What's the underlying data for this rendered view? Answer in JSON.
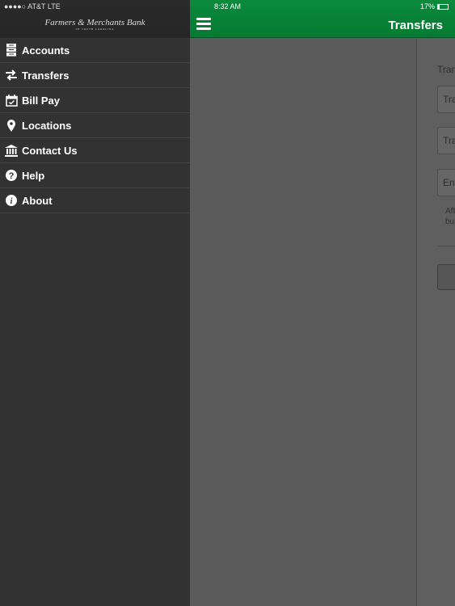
{
  "status_bar": {
    "carrier": "●●●●○ AT&T  LTE",
    "time": "8:32 AM",
    "battery": "17%",
    "battery_level": 0.17
  },
  "sidebar": {
    "logo": "Farmers & Merchants Bank",
    "items": [
      {
        "label": "Accounts",
        "icon": "accounts-icon"
      },
      {
        "label": "Transfers",
        "icon": "transfers-icon"
      },
      {
        "label": "Bill Pay",
        "icon": "calendar-check-icon"
      },
      {
        "label": "Locations",
        "icon": "map-pin-icon"
      },
      {
        "label": "Contact Us",
        "icon": "bank-icon"
      },
      {
        "label": "Help",
        "icon": "question-icon"
      },
      {
        "label": "About",
        "icon": "info-icon"
      }
    ]
  },
  "header": {
    "title": "Transfers"
  },
  "form": {
    "section_label": "Tran",
    "from_field": "Tra",
    "to_field": "Tra",
    "amount_field": "En",
    "note_line1": "Aft",
    "note_line2": "bu"
  },
  "colors": {
    "accent": "#0b8a3c",
    "sidebar": "#323232"
  }
}
